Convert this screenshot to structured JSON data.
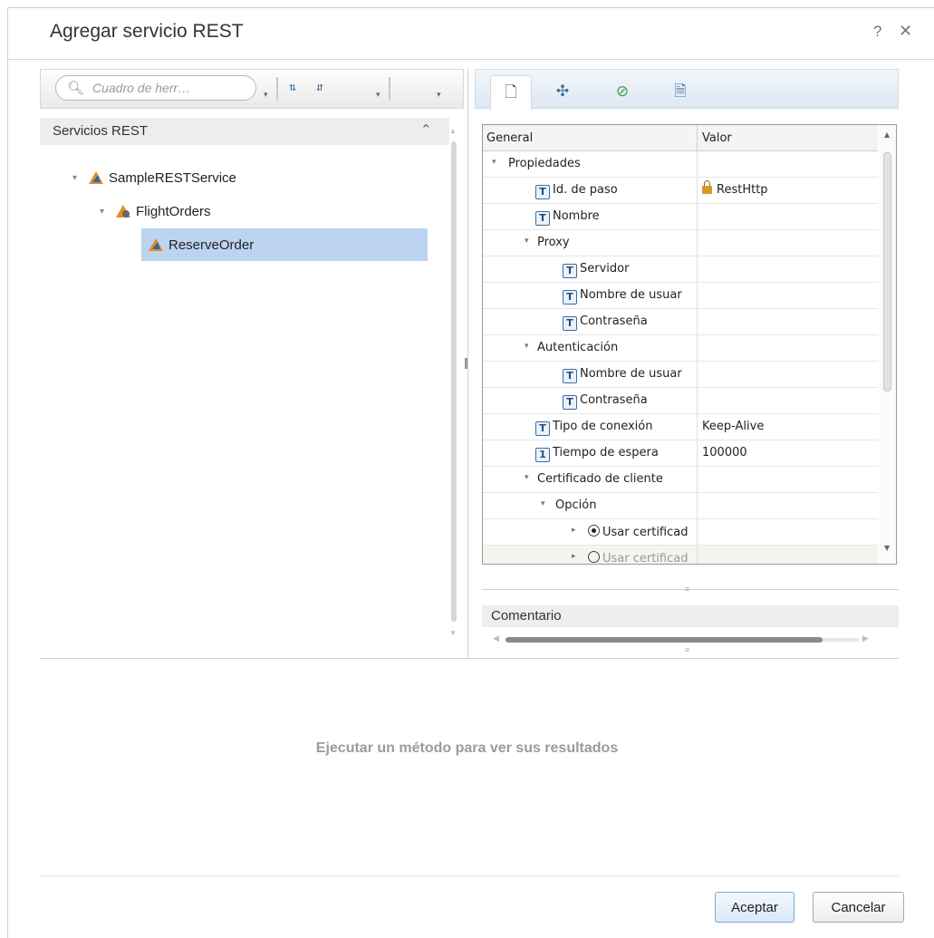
{
  "dialog": {
    "title": "Agregar servicio REST",
    "help": "?",
    "close": "✕"
  },
  "left_toolbar": {
    "search_placeholder": "Cuadro de herr…",
    "caret": "▾",
    "sort_asc_icon": "⇅",
    "sort_desc_icon": "⇵"
  },
  "services_panel": {
    "title": "Servicios REST",
    "collapse": "⌃",
    "tree": [
      {
        "label": "SampleRESTService",
        "expanded": true
      },
      {
        "label": "FlightOrders",
        "expanded": true
      },
      {
        "label": "ReserveOrder",
        "selected": true
      }
    ]
  },
  "right_tabs": [
    {
      "icon": "properties-icon",
      "glyph": "🗋",
      "active": true
    },
    {
      "icon": "transform-icon",
      "glyph": "✣"
    },
    {
      "icon": "checkpoint-icon",
      "glyph": "⊘"
    },
    {
      "icon": "events-icon",
      "glyph": "🗎"
    }
  ],
  "property_grid": {
    "col_general": "General",
    "col_value": "Valor",
    "rows": [
      {
        "name": "Propiedades",
        "expander": "▾",
        "type": "group"
      },
      {
        "name": "Id. de paso",
        "badge": "T",
        "value": "RestHttp",
        "locked": true
      },
      {
        "name": "Nombre",
        "badge": "T",
        "value": ""
      },
      {
        "name": "Proxy",
        "expander": "▾",
        "type": "group"
      },
      {
        "name": "Servidor",
        "badge": "T",
        "value": ""
      },
      {
        "name": "Nombre de usuar",
        "badge": "T",
        "value": ""
      },
      {
        "name": "Contraseña",
        "badge": "T",
        "value": ""
      },
      {
        "name": "Autenticación",
        "expander": "▾",
        "type": "group"
      },
      {
        "name": "Nombre de usuar",
        "badge": "T",
        "value": ""
      },
      {
        "name": "Contraseña",
        "badge": "T",
        "value": ""
      },
      {
        "name": "Tipo de conexión",
        "badge": "T",
        "value": "Keep-Alive"
      },
      {
        "name": "Tiempo de espera",
        "badge": "1",
        "value": "100000"
      },
      {
        "name": "Certificado de cliente",
        "expander": "▾",
        "type": "group"
      },
      {
        "name": "Opción",
        "expander": "▾",
        "type": "group"
      },
      {
        "name": "Usar certificad",
        "expander": "▸",
        "radio": "on"
      },
      {
        "name": "Usar certificad",
        "expander": "▸",
        "radio": "off"
      }
    ]
  },
  "comment": {
    "label": "Comentario"
  },
  "results": {
    "message": "Ejecutar un método para ver sus resultados"
  },
  "buttons": {
    "ok": "Aceptar",
    "cancel": "Cancelar"
  }
}
